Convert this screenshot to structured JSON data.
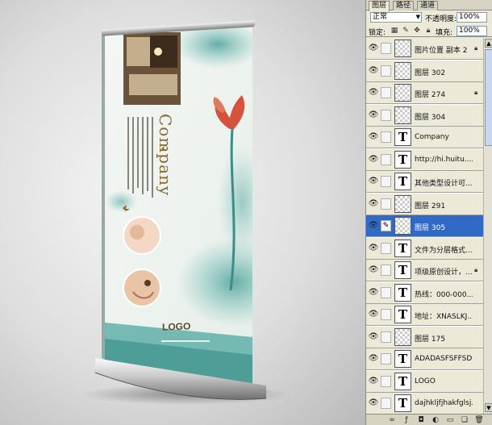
{
  "banner": {
    "company_text": "Company",
    "logo_text": "LOGO"
  },
  "panel": {
    "tabs": [
      "图层",
      "路径",
      "通道"
    ],
    "active_tab": 0,
    "blend_mode": "正常",
    "opacity_label": "不透明度:",
    "opacity_value": "100%",
    "lock_label": "锁定:",
    "fill_label": "填充:",
    "fill_value": "100%",
    "layers": [
      {
        "name": "图片位置 副本 2",
        "type": "image",
        "locked": true,
        "selected": false
      },
      {
        "name": "图层 302",
        "type": "image",
        "locked": false,
        "selected": false
      },
      {
        "name": "图层 274",
        "type": "image",
        "locked": true,
        "selected": false
      },
      {
        "name": "图层 304",
        "type": "image",
        "locked": false,
        "selected": false
      },
      {
        "name": "Company",
        "type": "text",
        "locked": false,
        "selected": false
      },
      {
        "name": "http://hi.huitu....",
        "type": "text",
        "locked": false,
        "selected": false
      },
      {
        "name": "其他类型设计可...",
        "type": "text",
        "locked": false,
        "selected": false
      },
      {
        "name": "图层 291",
        "type": "image",
        "locked": false,
        "selected": false
      },
      {
        "name": "图层 305",
        "type": "image",
        "locked": false,
        "selected": true
      },
      {
        "name": "文件为分层格式...",
        "type": "text",
        "locked": false,
        "selected": false
      },
      {
        "name": "项级原创设计，...",
        "type": "text",
        "locked": true,
        "selected": false
      },
      {
        "name": "热线：000-000...",
        "type": "text",
        "locked": false,
        "selected": false
      },
      {
        "name": "地址：XNASLKJ...",
        "type": "text",
        "locked": false,
        "selected": false
      },
      {
        "name": "图层 175",
        "type": "image",
        "locked": false,
        "selected": false
      },
      {
        "name": "ADADASFSFFSD",
        "type": "text",
        "locked": false,
        "selected": false
      },
      {
        "name": "LOGO",
        "type": "text",
        "locked": false,
        "selected": false
      },
      {
        "name": "dajhkljfjhakfglsj...",
        "type": "text",
        "locked": false,
        "selected": false
      }
    ]
  },
  "colors": {
    "selection": "#316ac5",
    "panel_bg": "#ece9d8",
    "banner_teal": "#5fb0a8",
    "banner_brown": "#8a6a2e"
  }
}
